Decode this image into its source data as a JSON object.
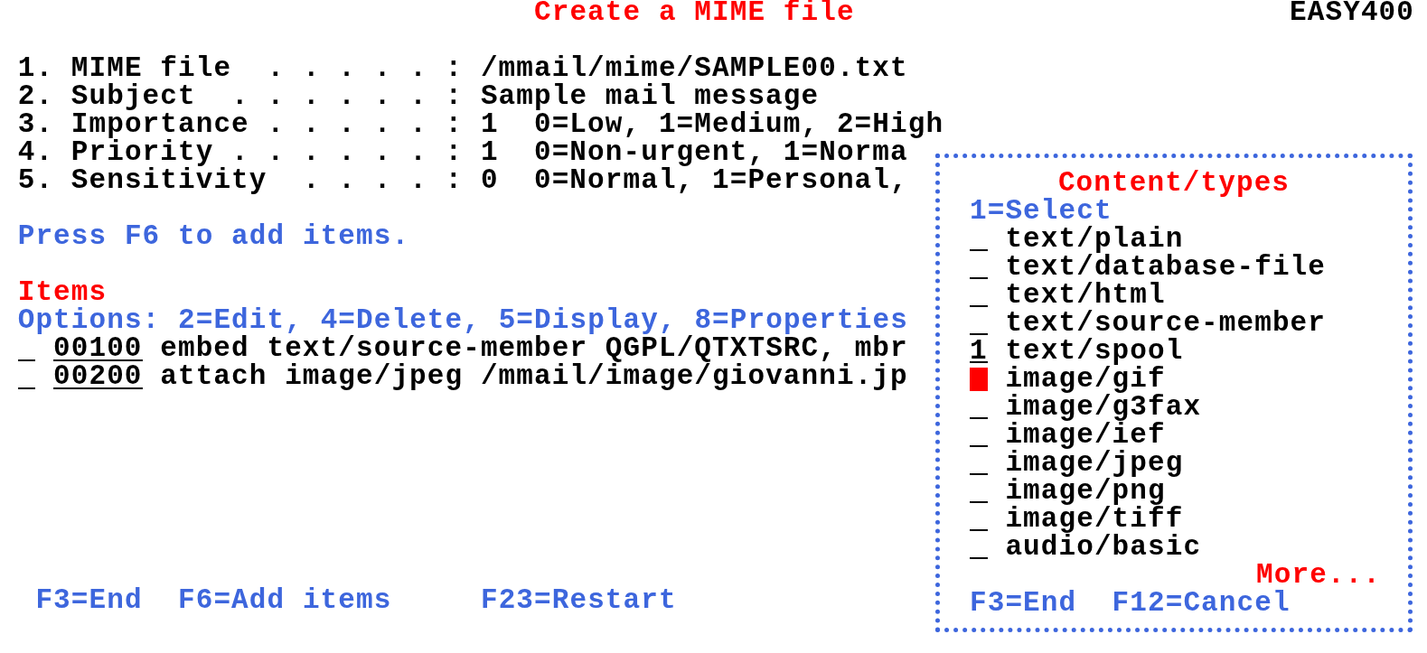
{
  "header": {
    "title": "Create a MIME file",
    "system": "EASY400"
  },
  "fields": [
    {
      "label": "1. MIME file  . . . . . :",
      "value": "/mmail/mime/SAMPLE00.txt"
    },
    {
      "label": "2. Subject  . . . . . . :",
      "value": "Sample mail message"
    },
    {
      "label": "3. Importance . . . . . :",
      "value": "1",
      "hint": "0=Low, 1=Medium, 2=High"
    },
    {
      "label": "4. Priority . . . . . . :",
      "value": "1",
      "hint": "0=Non-urgent, 1=Norma"
    },
    {
      "label": "5. Sensitivity  . . . . :",
      "value": "0",
      "hint": "0=Normal, 1=Personal,"
    }
  ],
  "message": "Press F6 to add items.",
  "items_section": {
    "title": "Items",
    "options": "Options: 2=Edit, 4=Delete, 5=Display, 8=Properties",
    "rows": [
      {
        "seq": "00100",
        "text": "embed text/source-member QGPL/QTXTSRC, mbr"
      },
      {
        "seq": "00200",
        "text": "attach image/jpeg /mmail/image/giovanni.jp"
      }
    ]
  },
  "function_keys": [
    "F3=End",
    "F6=Add items",
    "F23=Restart"
  ],
  "popup": {
    "title": "Content/types",
    "instructions": "1=Select",
    "options": [
      {
        "label": "text/plain",
        "focused": false
      },
      {
        "label": "text/database-file",
        "focused": false
      },
      {
        "label": "text/html",
        "focused": false
      },
      {
        "label": "text/source-member",
        "focused": false
      },
      {
        "label": "text/spool",
        "input": "1",
        "focused": false
      },
      {
        "label": "image/gif",
        "focused": true
      },
      {
        "label": "image/g3fax",
        "focused": false
      },
      {
        "label": "image/ief",
        "focused": false
      },
      {
        "label": "image/jpeg",
        "focused": false
      },
      {
        "label": "image/png",
        "focused": false
      },
      {
        "label": "image/tiff",
        "focused": false
      },
      {
        "label": "audio/basic",
        "focused": false
      }
    ],
    "more": "More...",
    "function_keys": [
      "F3=End",
      "F12=Cancel"
    ]
  }
}
